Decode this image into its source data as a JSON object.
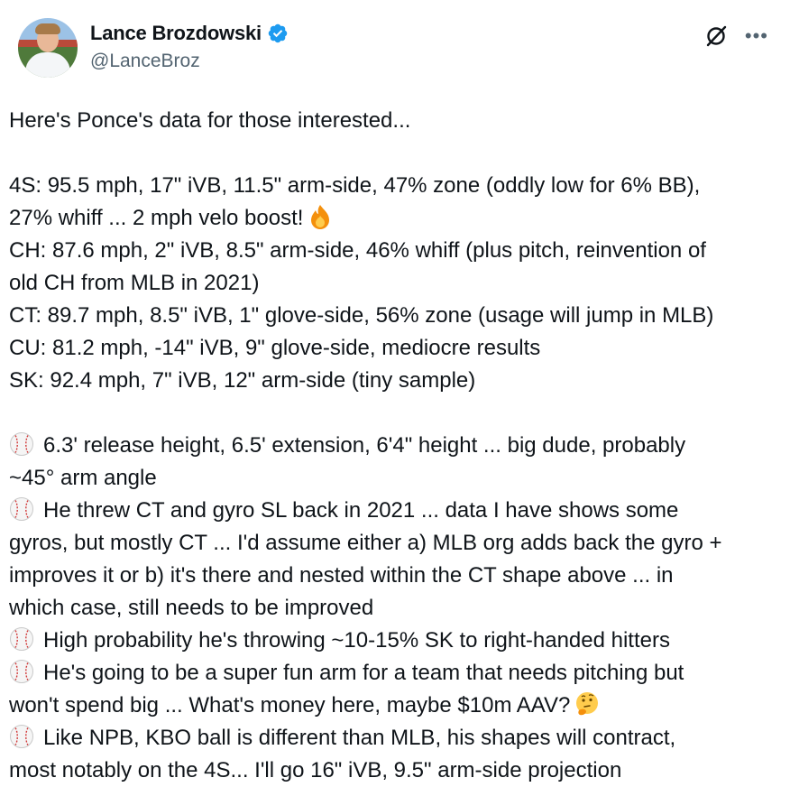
{
  "author": {
    "display_name": "Lance Brozdowski",
    "handle": "@LanceBroz"
  },
  "tweet": {
    "lines": [
      {
        "type": "text",
        "text": "Here's Ponce's data for those interested..."
      },
      {
        "type": "blank"
      },
      {
        "type": "text",
        "text": "4S: 95.5 mph, 17\" iVB, 11.5\" arm-side, 47% zone (oddly low for 6% BB),"
      },
      {
        "type": "text",
        "text": "27% whiff ... 2 mph velo boost!",
        "emoji_after": "fire"
      },
      {
        "type": "text",
        "text": "CH: 87.6 mph, 2\" iVB, 8.5\" arm-side, 46% whiff (plus pitch, reinvention of"
      },
      {
        "type": "text",
        "text": "old CH from MLB in 2021)"
      },
      {
        "type": "text",
        "text": "CT: 89.7 mph, 8.5\" iVB, 1\" glove-side, 56% zone (usage will jump in MLB)"
      },
      {
        "type": "text",
        "text": "CU: 81.2 mph, -14\" iVB, 9\" glove-side, mediocre results"
      },
      {
        "type": "text",
        "text": "SK: 92.4 mph, 7\" iVB, 12\" arm-side (tiny sample)"
      },
      {
        "type": "blank"
      },
      {
        "type": "text",
        "text": "6.3' release height, 6.5' extension, 6'4\" height ... big dude, probably",
        "emoji_before": "baseball"
      },
      {
        "type": "text",
        "text": "~45° arm angle"
      },
      {
        "type": "text",
        "text": "He threw CT and gyro SL back in 2021 ... data I have shows some",
        "emoji_before": "baseball"
      },
      {
        "type": "text",
        "text": "gyros, but mostly CT ... I'd assume either a) MLB org adds back the gyro +"
      },
      {
        "type": "text",
        "text": "improves it or b) it's there and nested within the CT shape above ... in"
      },
      {
        "type": "text",
        "text": "which case, still needs to be improved"
      },
      {
        "type": "text",
        "text": "High probability he's throwing ~10-15% SK to right-handed hitters",
        "emoji_before": "baseball"
      },
      {
        "type": "text",
        "text": "He's going to be a super fun arm for a team that needs pitching but",
        "emoji_before": "baseball"
      },
      {
        "type": "text",
        "text": "won't spend big ... What's money here, maybe $10m AAV?",
        "emoji_after": "thinking"
      },
      {
        "type": "text",
        "text": "Like NPB, KBO ball is different than MLB, his shapes will contract,",
        "emoji_before": "baseball"
      },
      {
        "type": "text",
        "text": "most notably on the 4S... I'll go 16\" iVB, 9.5\" arm-side projection"
      }
    ]
  },
  "icons": {
    "verified": "verified-badge-icon",
    "grok": "grok-icon",
    "more": "more-options-icon"
  },
  "colors": {
    "verified_blue": "#1d9bf0",
    "text": "#0f1419",
    "secondary": "#536471"
  }
}
